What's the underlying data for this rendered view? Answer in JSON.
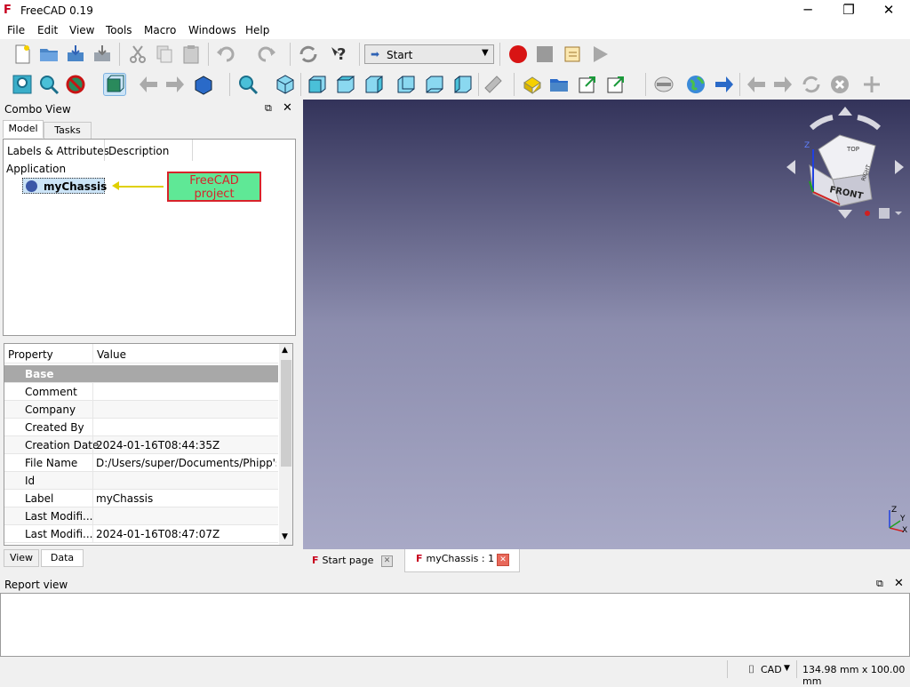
{
  "window": {
    "title": "FreeCAD 0.19",
    "minimize": "─",
    "maximize": "❐",
    "close": "✕"
  },
  "menu": [
    "File",
    "Edit",
    "View",
    "Tools",
    "Macro",
    "Windows",
    "Help"
  ],
  "workbench": {
    "selected": "Start"
  },
  "combo_view": {
    "title": "Combo View",
    "tabs": [
      "Model",
      "Tasks"
    ],
    "tree_headers": [
      "Labels & Attributes",
      "Description"
    ],
    "tree_root": "Application",
    "tree_item": "myChassis",
    "annotation": "FreeCAD project"
  },
  "property_panel": {
    "headers": [
      "Property",
      "Value"
    ],
    "group": "Base",
    "rows": [
      {
        "name": "Comment",
        "value": ""
      },
      {
        "name": "Company",
        "value": ""
      },
      {
        "name": "Created By",
        "value": ""
      },
      {
        "name": "Creation Date",
        "value": "2024-01-16T08:44:35Z"
      },
      {
        "name": "File Name",
        "value": "D:/Users/super/Documents/Phipp's..."
      },
      {
        "name": "Id",
        "value": ""
      },
      {
        "name": "Label",
        "value": "myChassis"
      },
      {
        "name": "Last Modifi...",
        "value": ""
      },
      {
        "name": "Last Modifi...",
        "value": "2024-01-16T08:47:07Z"
      }
    ],
    "bottom_tabs": [
      "View",
      "Data"
    ]
  },
  "view_tabs": [
    "Start page",
    "myChassis : 1"
  ],
  "navcube": {
    "face_front": "FRONT",
    "face_top": "TOP",
    "face_right": "RIGHT"
  },
  "axis": {
    "x": "X",
    "y": "Y",
    "z": "Z"
  },
  "report_view": {
    "title": "Report view"
  },
  "status": {
    "nav_style": "CAD",
    "dimensions": "134.98 mm x 100.00 mm"
  },
  "colors": {
    "viewport_top": "#33335a",
    "viewport_bottom": "#a8a9c6",
    "annotation_fill": "#5fe896",
    "annotation_border": "#d8232a"
  }
}
